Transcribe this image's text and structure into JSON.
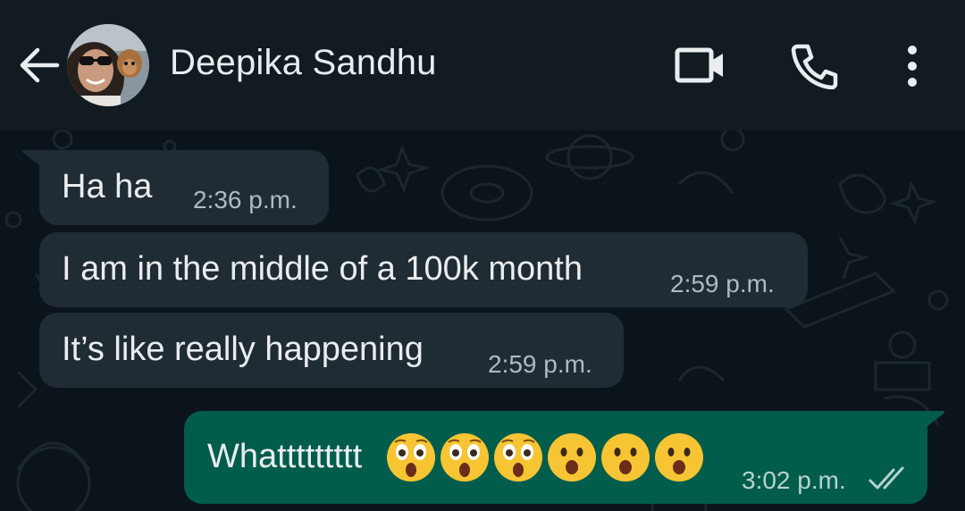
{
  "header": {
    "contact_name": "Deepika Sandhu",
    "icons": {
      "back": "arrow-left-icon",
      "video": "video-camera-icon",
      "call": "phone-icon",
      "menu": "more-vertical-icon"
    }
  },
  "messages": [
    {
      "direction": "incoming",
      "text": "Ha ha",
      "time": "2:36 p.m."
    },
    {
      "direction": "incoming",
      "text": "I am in the middle of a 100k month",
      "time": "2:59 p.m."
    },
    {
      "direction": "incoming",
      "text": "It’s like really happening",
      "time": "2:59 p.m."
    },
    {
      "direction": "outgoing",
      "text": "Whattttttttt",
      "emojis": [
        "astonished-face",
        "astonished-face",
        "astonished-face",
        "open-mouth-face",
        "open-mouth-face",
        "open-mouth-face"
      ],
      "time": "3:02 p.m.",
      "status": "read-double-check"
    }
  ],
  "colors": {
    "header_bg": "#111b21",
    "chat_bg": "#0b141a",
    "incoming_bubble": "#202c33",
    "outgoing_bubble": "#005c4b",
    "text": "#e9edef",
    "timestamp": "#aebac1"
  }
}
